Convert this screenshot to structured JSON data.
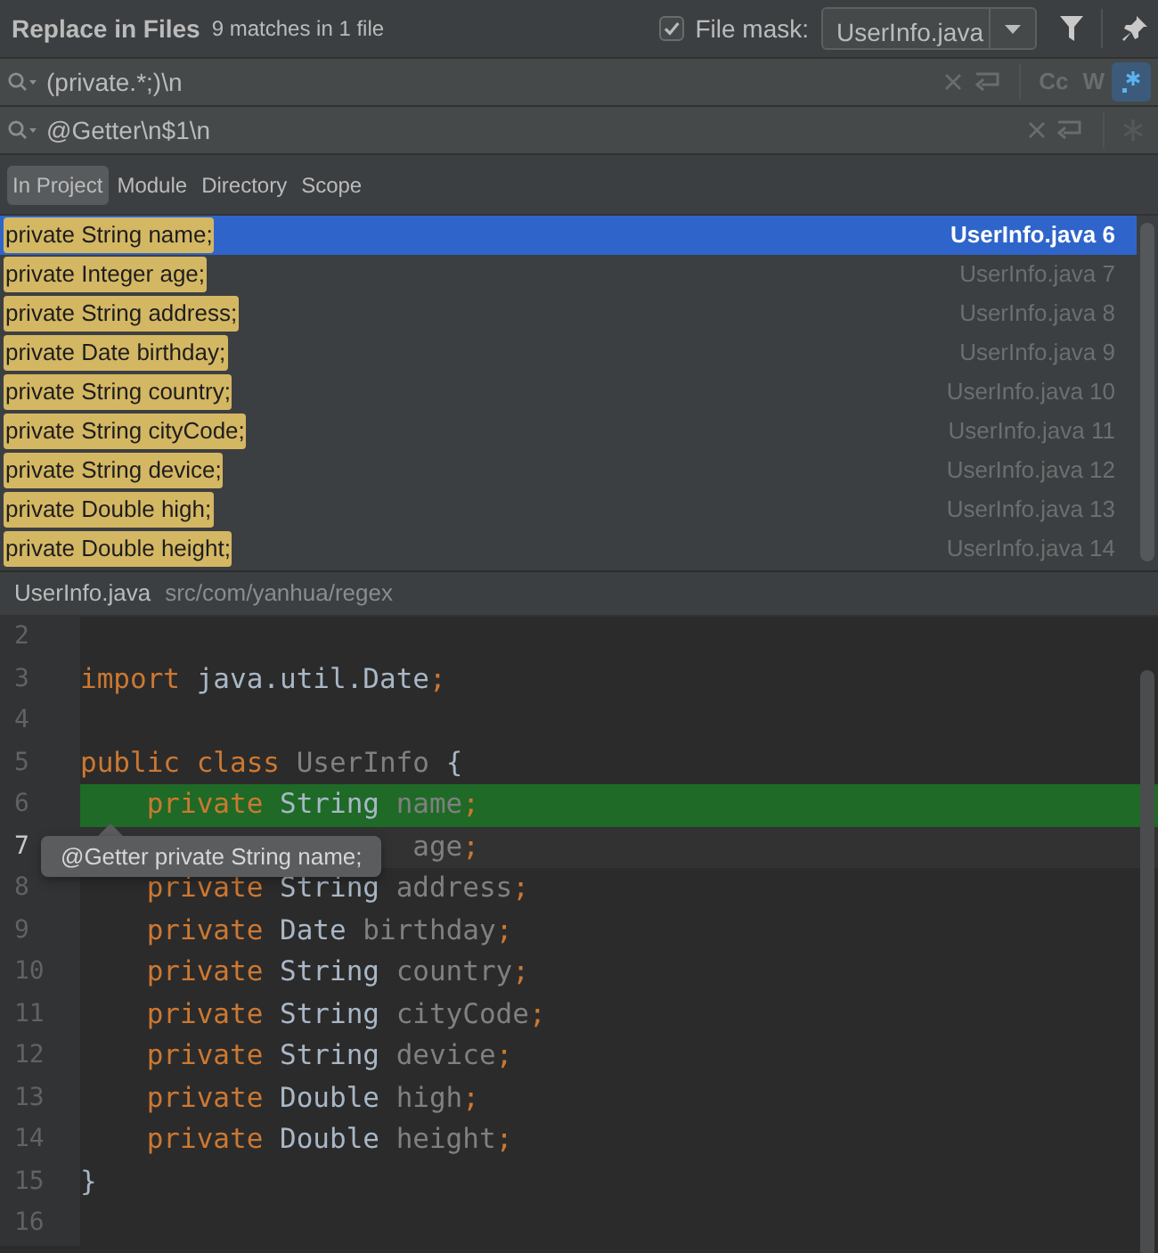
{
  "dialog": {
    "title": "Replace in Files",
    "match_count": "9 matches in 1 file",
    "file_mask_enabled": true,
    "file_mask_label": "File mask:",
    "file_mask": "UserInfo.java"
  },
  "search": {
    "value": "(private.*;)\\n",
    "case_label": "Cc",
    "words_label": "W",
    "regex_selected": true
  },
  "replace": {
    "value": "@Getter\\n$1\\n"
  },
  "scopes": [
    {
      "label": "In Project",
      "selected": true
    },
    {
      "label": "Module",
      "selected": false
    },
    {
      "label": "Directory",
      "selected": false
    },
    {
      "label": "Scope",
      "selected": false
    }
  ],
  "results": [
    {
      "text": "private String name;",
      "location": "UserInfo.java 6",
      "selected": true
    },
    {
      "text": "private Integer age;",
      "location": "UserInfo.java 7",
      "selected": false
    },
    {
      "text": "private String address;",
      "location": "UserInfo.java 8",
      "selected": false
    },
    {
      "text": "private Date birthday;",
      "location": "UserInfo.java 9",
      "selected": false
    },
    {
      "text": "private String country;",
      "location": "UserInfo.java 10",
      "selected": false
    },
    {
      "text": "private String cityCode;",
      "location": "UserInfo.java 11",
      "selected": false
    },
    {
      "text": "private String device;",
      "location": "UserInfo.java 12",
      "selected": false
    },
    {
      "text": "private Double high;",
      "location": "UserInfo.java 13",
      "selected": false
    },
    {
      "text": "private Double height;",
      "location": "UserInfo.java 14",
      "selected": false
    }
  ],
  "preview": {
    "file": "UserInfo.java",
    "path": "src/com/yanhua/regex"
  },
  "code_lines": [
    {
      "number": "2",
      "highlighted": false,
      "current": false
    },
    {
      "number": "3",
      "highlighted": false,
      "current": false,
      "tokens": [
        {
          "kind": "keyword",
          "text": "import"
        },
        {
          "kind": "plain",
          "text": " java.util.Date"
        },
        {
          "kind": "keyword",
          "text": ";"
        }
      ]
    },
    {
      "number": "4",
      "highlighted": false,
      "current": false
    },
    {
      "number": "5",
      "highlighted": false,
      "current": false,
      "tokens": [
        {
          "kind": "keyword",
          "text": "public class"
        },
        {
          "kind": "unused",
          "text": " UserInfo"
        },
        {
          "kind": "plain",
          "text": " {"
        }
      ]
    },
    {
      "number": "6",
      "highlighted": true,
      "current": false,
      "tokens": [
        {
          "kind": "keyword",
          "text": "    private"
        },
        {
          "kind": "plain",
          "text": " String"
        },
        {
          "kind": "unused",
          "text": " name"
        },
        {
          "kind": "keyword",
          "text": ";"
        }
      ]
    },
    {
      "number": "7",
      "highlighted": false,
      "current": true,
      "tokens": [
        {
          "kind": "unused",
          "text": "                    age"
        },
        {
          "kind": "keyword",
          "text": ";"
        }
      ]
    },
    {
      "number": "8",
      "highlighted": false,
      "current": false,
      "tokens": [
        {
          "kind": "keyword",
          "text": "    private"
        },
        {
          "kind": "plain",
          "text": " String"
        },
        {
          "kind": "unused",
          "text": " address"
        },
        {
          "kind": "keyword",
          "text": ";"
        }
      ]
    },
    {
      "number": "9",
      "highlighted": false,
      "current": false,
      "tokens": [
        {
          "kind": "keyword",
          "text": "    private"
        },
        {
          "kind": "plain",
          "text": " Date"
        },
        {
          "kind": "unused",
          "text": " birthday"
        },
        {
          "kind": "keyword",
          "text": ";"
        }
      ]
    },
    {
      "number": "10",
      "highlighted": false,
      "current": false,
      "tokens": [
        {
          "kind": "keyword",
          "text": "    private"
        },
        {
          "kind": "plain",
          "text": " String"
        },
        {
          "kind": "unused",
          "text": " country"
        },
        {
          "kind": "keyword",
          "text": ";"
        }
      ]
    },
    {
      "number": "11",
      "highlighted": false,
      "current": false,
      "tokens": [
        {
          "kind": "keyword",
          "text": "    private"
        },
        {
          "kind": "plain",
          "text": " String"
        },
        {
          "kind": "unused",
          "text": " cityCode"
        },
        {
          "kind": "keyword",
          "text": ";"
        }
      ]
    },
    {
      "number": "12",
      "highlighted": false,
      "current": false,
      "tokens": [
        {
          "kind": "keyword",
          "text": "    private"
        },
        {
          "kind": "plain",
          "text": " String"
        },
        {
          "kind": "unused",
          "text": " device"
        },
        {
          "kind": "keyword",
          "text": ";"
        }
      ]
    },
    {
      "number": "13",
      "highlighted": false,
      "current": false,
      "tokens": [
        {
          "kind": "keyword",
          "text": "    private"
        },
        {
          "kind": "plain",
          "text": " Double"
        },
        {
          "kind": "unused",
          "text": " high"
        },
        {
          "kind": "keyword",
          "text": ";"
        }
      ]
    },
    {
      "number": "14",
      "highlighted": false,
      "current": false,
      "tokens": [
        {
          "kind": "keyword",
          "text": "    private"
        },
        {
          "kind": "plain",
          "text": " Double"
        },
        {
          "kind": "unused",
          "text": " height"
        },
        {
          "kind": "keyword",
          "text": ";"
        }
      ]
    },
    {
      "number": "15",
      "highlighted": false,
      "current": false,
      "tokens": [
        {
          "kind": "plain",
          "text": "}"
        }
      ]
    },
    {
      "number": "16",
      "highlighted": false,
      "current": false
    }
  ],
  "tooltip": {
    "text": "@Getter private String name;"
  }
}
